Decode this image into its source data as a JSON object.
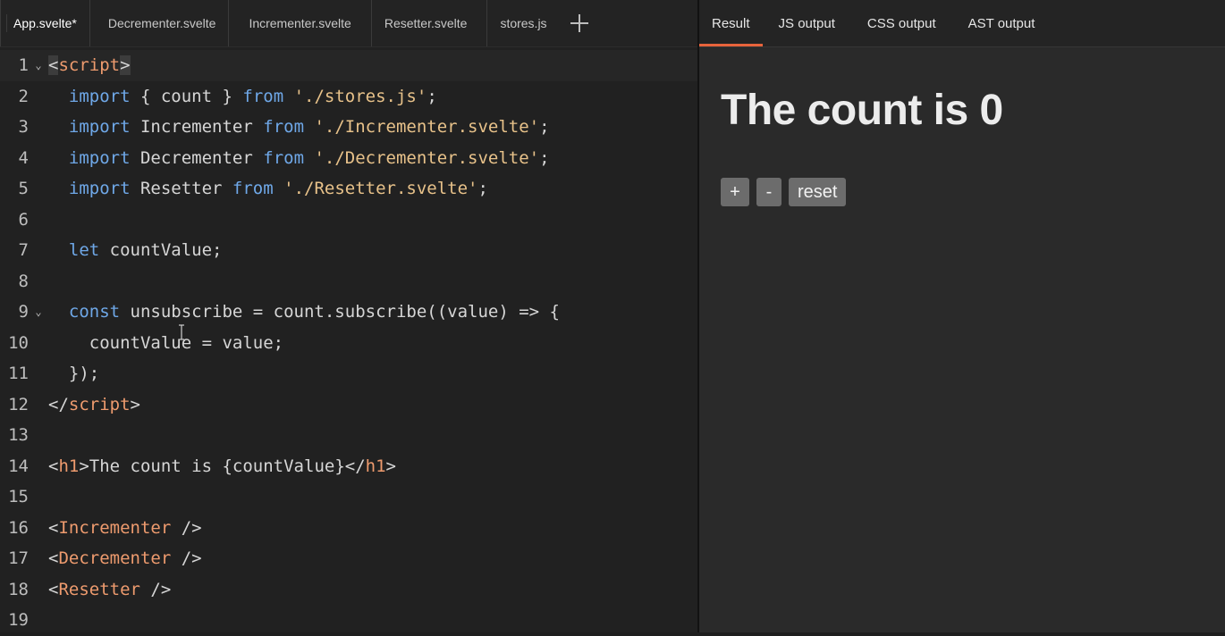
{
  "editor": {
    "tabs": [
      "App.svelte*",
      "Decrementer.svelte",
      "Incrementer.svelte",
      "Resetter.svelte",
      "stores.js"
    ],
    "add_tab_icon": "plus-icon",
    "fold_icon": "chevron-down-icon",
    "line_numbers": [
      "1",
      "2",
      "3",
      "4",
      "5",
      "6",
      "7",
      "8",
      "9",
      "10",
      "11",
      "12",
      "13",
      "14",
      "15",
      "16",
      "17",
      "18",
      "19"
    ],
    "lines": {
      "l1": {
        "open": "<",
        "tag": "script",
        "close": ">"
      },
      "l2": {
        "kw1": "import",
        "mid": " { count } ",
        "kw2": "from",
        "sp": " ",
        "str": "'./stores.js'",
        "end": ";"
      },
      "l3": {
        "kw1": "import",
        "mid": " Incrementer ",
        "kw2": "from",
        "sp": " ",
        "str": "'./Incrementer.svelte'",
        "end": ";"
      },
      "l4": {
        "kw1": "import",
        "mid": " Decrementer ",
        "kw2": "from",
        "sp": " ",
        "str": "'./Decrementer.svelte'",
        "end": ";"
      },
      "l5": {
        "kw1": "import",
        "mid": " Resetter ",
        "kw2": "from",
        "sp": " ",
        "str": "'./Resetter.svelte'",
        "end": ";"
      },
      "l7": {
        "kw": "let",
        "rest": " countValue;"
      },
      "l9": {
        "kw": "const",
        "rest": " unsubscribe = count.subscribe((value) => {"
      },
      "l10": {
        "text": "countValue = value;"
      },
      "l11": {
        "text": "});"
      },
      "l12": {
        "open": "</",
        "tag": "script",
        "close": ">"
      },
      "l14": {
        "open": "<",
        "tag": "h1",
        "mid": ">The count is {countValue}</",
        "tag2": "h1",
        "close": ">"
      },
      "l16": {
        "open": "<",
        "tag": "Incrementer",
        "close": " />"
      },
      "l17": {
        "open": "<",
        "tag": "Decrementer",
        "close": " />"
      },
      "l18": {
        "open": "<",
        "tag": "Resetter",
        "close": " />"
      }
    }
  },
  "output": {
    "tabs": [
      "Result",
      "JS output",
      "CSS output",
      "AST output"
    ],
    "active_tab": "Result",
    "heading": "The count is 0",
    "buttons": [
      "+",
      "-",
      "reset"
    ]
  },
  "colors": {
    "keyword": "#6fa8e8",
    "string": "#e8c28a",
    "tag": "#ee9b6e",
    "active_tab_underline": "#e8643c"
  }
}
